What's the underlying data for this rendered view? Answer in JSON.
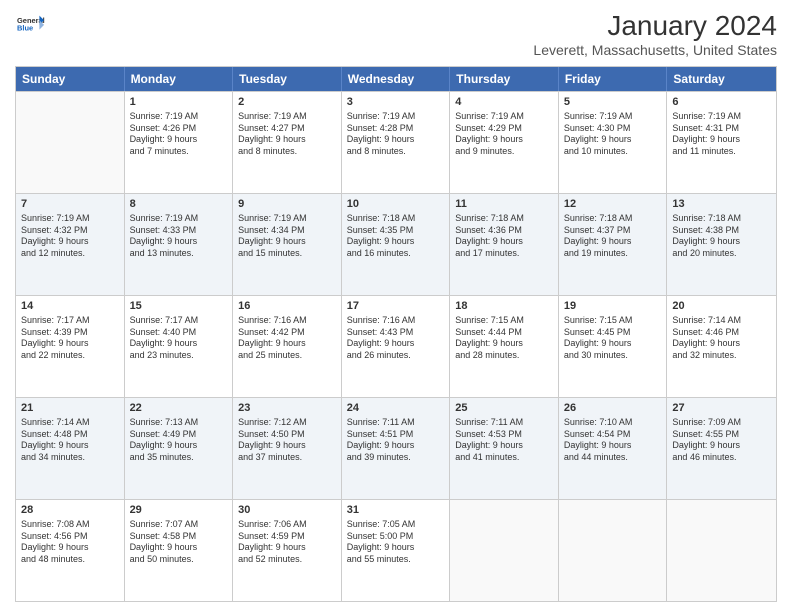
{
  "logo": {
    "general": "General",
    "blue": "Blue"
  },
  "title": "January 2024",
  "subtitle": "Leverett, Massachusetts, United States",
  "headers": [
    "Sunday",
    "Monday",
    "Tuesday",
    "Wednesday",
    "Thursday",
    "Friday",
    "Saturday"
  ],
  "rows": [
    [
      {
        "day": "",
        "lines": [],
        "shaded": false
      },
      {
        "day": "1",
        "lines": [
          "Sunrise: 7:19 AM",
          "Sunset: 4:26 PM",
          "Daylight: 9 hours",
          "and 7 minutes."
        ],
        "shaded": false
      },
      {
        "day": "2",
        "lines": [
          "Sunrise: 7:19 AM",
          "Sunset: 4:27 PM",
          "Daylight: 9 hours",
          "and 8 minutes."
        ],
        "shaded": false
      },
      {
        "day": "3",
        "lines": [
          "Sunrise: 7:19 AM",
          "Sunset: 4:28 PM",
          "Daylight: 9 hours",
          "and 8 minutes."
        ],
        "shaded": false
      },
      {
        "day": "4",
        "lines": [
          "Sunrise: 7:19 AM",
          "Sunset: 4:29 PM",
          "Daylight: 9 hours",
          "and 9 minutes."
        ],
        "shaded": false
      },
      {
        "day": "5",
        "lines": [
          "Sunrise: 7:19 AM",
          "Sunset: 4:30 PM",
          "Daylight: 9 hours",
          "and 10 minutes."
        ],
        "shaded": false
      },
      {
        "day": "6",
        "lines": [
          "Sunrise: 7:19 AM",
          "Sunset: 4:31 PM",
          "Daylight: 9 hours",
          "and 11 minutes."
        ],
        "shaded": false
      }
    ],
    [
      {
        "day": "7",
        "lines": [
          "Sunrise: 7:19 AM",
          "Sunset: 4:32 PM",
          "Daylight: 9 hours",
          "and 12 minutes."
        ],
        "shaded": true
      },
      {
        "day": "8",
        "lines": [
          "Sunrise: 7:19 AM",
          "Sunset: 4:33 PM",
          "Daylight: 9 hours",
          "and 13 minutes."
        ],
        "shaded": true
      },
      {
        "day": "9",
        "lines": [
          "Sunrise: 7:19 AM",
          "Sunset: 4:34 PM",
          "Daylight: 9 hours",
          "and 15 minutes."
        ],
        "shaded": true
      },
      {
        "day": "10",
        "lines": [
          "Sunrise: 7:18 AM",
          "Sunset: 4:35 PM",
          "Daylight: 9 hours",
          "and 16 minutes."
        ],
        "shaded": true
      },
      {
        "day": "11",
        "lines": [
          "Sunrise: 7:18 AM",
          "Sunset: 4:36 PM",
          "Daylight: 9 hours",
          "and 17 minutes."
        ],
        "shaded": true
      },
      {
        "day": "12",
        "lines": [
          "Sunrise: 7:18 AM",
          "Sunset: 4:37 PM",
          "Daylight: 9 hours",
          "and 19 minutes."
        ],
        "shaded": true
      },
      {
        "day": "13",
        "lines": [
          "Sunrise: 7:18 AM",
          "Sunset: 4:38 PM",
          "Daylight: 9 hours",
          "and 20 minutes."
        ],
        "shaded": true
      }
    ],
    [
      {
        "day": "14",
        "lines": [
          "Sunrise: 7:17 AM",
          "Sunset: 4:39 PM",
          "Daylight: 9 hours",
          "and 22 minutes."
        ],
        "shaded": false
      },
      {
        "day": "15",
        "lines": [
          "Sunrise: 7:17 AM",
          "Sunset: 4:40 PM",
          "Daylight: 9 hours",
          "and 23 minutes."
        ],
        "shaded": false
      },
      {
        "day": "16",
        "lines": [
          "Sunrise: 7:16 AM",
          "Sunset: 4:42 PM",
          "Daylight: 9 hours",
          "and 25 minutes."
        ],
        "shaded": false
      },
      {
        "day": "17",
        "lines": [
          "Sunrise: 7:16 AM",
          "Sunset: 4:43 PM",
          "Daylight: 9 hours",
          "and 26 minutes."
        ],
        "shaded": false
      },
      {
        "day": "18",
        "lines": [
          "Sunrise: 7:15 AM",
          "Sunset: 4:44 PM",
          "Daylight: 9 hours",
          "and 28 minutes."
        ],
        "shaded": false
      },
      {
        "day": "19",
        "lines": [
          "Sunrise: 7:15 AM",
          "Sunset: 4:45 PM",
          "Daylight: 9 hours",
          "and 30 minutes."
        ],
        "shaded": false
      },
      {
        "day": "20",
        "lines": [
          "Sunrise: 7:14 AM",
          "Sunset: 4:46 PM",
          "Daylight: 9 hours",
          "and 32 minutes."
        ],
        "shaded": false
      }
    ],
    [
      {
        "day": "21",
        "lines": [
          "Sunrise: 7:14 AM",
          "Sunset: 4:48 PM",
          "Daylight: 9 hours",
          "and 34 minutes."
        ],
        "shaded": true
      },
      {
        "day": "22",
        "lines": [
          "Sunrise: 7:13 AM",
          "Sunset: 4:49 PM",
          "Daylight: 9 hours",
          "and 35 minutes."
        ],
        "shaded": true
      },
      {
        "day": "23",
        "lines": [
          "Sunrise: 7:12 AM",
          "Sunset: 4:50 PM",
          "Daylight: 9 hours",
          "and 37 minutes."
        ],
        "shaded": true
      },
      {
        "day": "24",
        "lines": [
          "Sunrise: 7:11 AM",
          "Sunset: 4:51 PM",
          "Daylight: 9 hours",
          "and 39 minutes."
        ],
        "shaded": true
      },
      {
        "day": "25",
        "lines": [
          "Sunrise: 7:11 AM",
          "Sunset: 4:53 PM",
          "Daylight: 9 hours",
          "and 41 minutes."
        ],
        "shaded": true
      },
      {
        "day": "26",
        "lines": [
          "Sunrise: 7:10 AM",
          "Sunset: 4:54 PM",
          "Daylight: 9 hours",
          "and 44 minutes."
        ],
        "shaded": true
      },
      {
        "day": "27",
        "lines": [
          "Sunrise: 7:09 AM",
          "Sunset: 4:55 PM",
          "Daylight: 9 hours",
          "and 46 minutes."
        ],
        "shaded": true
      }
    ],
    [
      {
        "day": "28",
        "lines": [
          "Sunrise: 7:08 AM",
          "Sunset: 4:56 PM",
          "Daylight: 9 hours",
          "and 48 minutes."
        ],
        "shaded": false
      },
      {
        "day": "29",
        "lines": [
          "Sunrise: 7:07 AM",
          "Sunset: 4:58 PM",
          "Daylight: 9 hours",
          "and 50 minutes."
        ],
        "shaded": false
      },
      {
        "day": "30",
        "lines": [
          "Sunrise: 7:06 AM",
          "Sunset: 4:59 PM",
          "Daylight: 9 hours",
          "and 52 minutes."
        ],
        "shaded": false
      },
      {
        "day": "31",
        "lines": [
          "Sunrise: 7:05 AM",
          "Sunset: 5:00 PM",
          "Daylight: 9 hours",
          "and 55 minutes."
        ],
        "shaded": false
      },
      {
        "day": "",
        "lines": [],
        "shaded": false
      },
      {
        "day": "",
        "lines": [],
        "shaded": false
      },
      {
        "day": "",
        "lines": [],
        "shaded": false
      }
    ]
  ]
}
